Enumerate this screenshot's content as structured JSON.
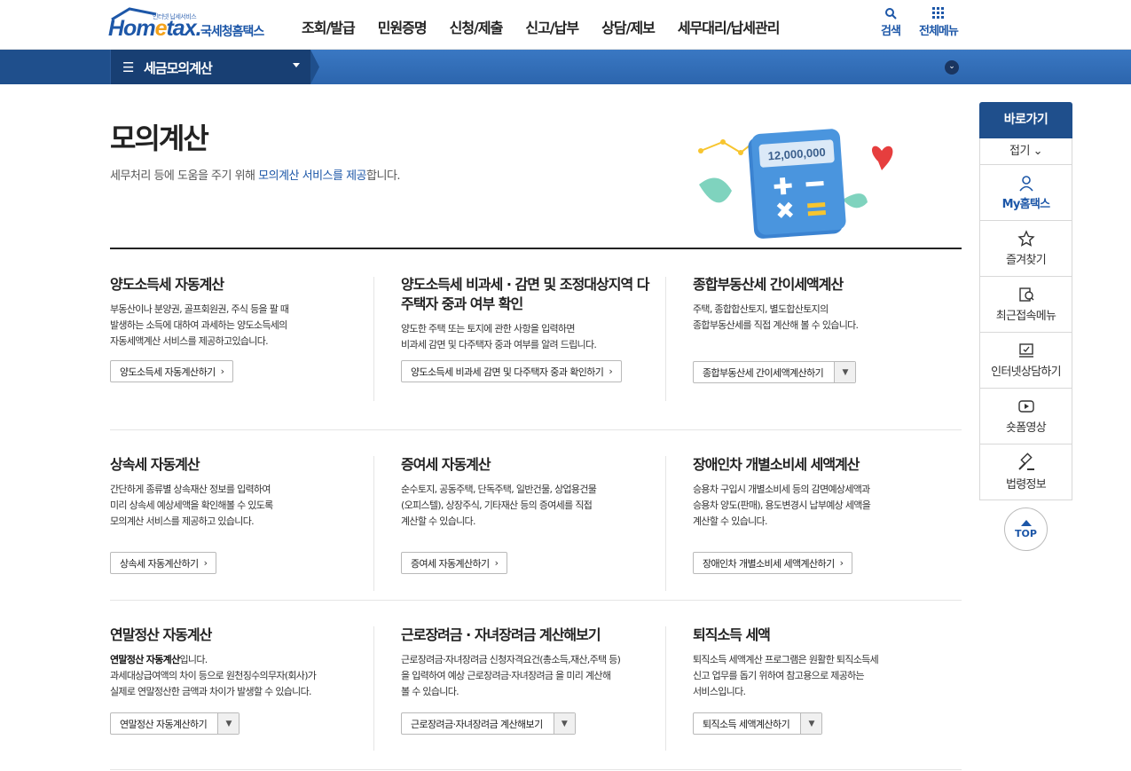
{
  "header": {
    "logo_small": "인터넷 납세서비스",
    "logo_word_start": "Hom",
    "logo_word_e": "e",
    "logo_word_end": "tax.",
    "logo_kor": "국세청홈택스",
    "gnb": [
      "조회/발급",
      "민원증명",
      "신청/제출",
      "신고/납부",
      "상담/제보",
      "세무대리/납세관리"
    ],
    "search_label": "검색",
    "allmenu_label": "전체메뉴"
  },
  "subbar": {
    "title": "세금모의계산"
  },
  "page": {
    "title": "모의계산",
    "desc_pre": "세무처리 등에 도움을 주기 위해 ",
    "desc_hl": "모의계산 서비스를 제공",
    "desc_post": "합니다.",
    "hero_amount": "12,000,000"
  },
  "cards": [
    {
      "title": "양도소득세 자동계산",
      "desc": [
        "부동산이나 분양권, 골프회원권, 주식 등을 팔 때",
        "발생하는 소득에 대하여 과세하는 양도소득세의",
        "자동세액계산 서비스를 제공하고있습니다."
      ],
      "button": "양도소득세 자동계산하기"
    },
    {
      "title": "양도소득세 비과세 · 감면 및 조정대상지역 다주택자 중과 여부 확인",
      "desc": [
        "양도한 주택 또는 토지에 관한 사항을 입력하면",
        "비과세 감면 및 다주택자 중과 여부를 알려 드립니다."
      ],
      "button": "양도소득세 비과세 감면 및 다주택자 중과 확인하기"
    },
    {
      "title": "종합부동산세 간이세액계산",
      "desc": [
        "주택, 종합합산토지, 별도합산토지의",
        "종합부동산세를 직접 계산해 볼 수 있습니다."
      ],
      "button": "종합부동산세 간이세액계산하기"
    },
    {
      "title": "상속세 자동계산",
      "desc": [
        "간단하게 종류별 상속재산 정보를 입력하여",
        "미리 상속세 예상세액을 확인해볼 수 있도록",
        "모의계산 서비스를 제공하고 있습니다."
      ],
      "button": "상속세 자동계산하기"
    },
    {
      "title": "증여세 자동계산",
      "desc": [
        "순수토지, 공동주택, 단독주택, 일반건물, 상업용건물",
        "(오피스텔), 상장주식, 기타재산 등의 증여세를 직접",
        "계산할 수 있습니다."
      ],
      "button": "증여세 자동계산하기"
    },
    {
      "title": "장애인차 개별소비세 세액계산",
      "desc": [
        "승용차 구입시 개별소비세 등의 감면예상세액과",
        "승용차 양도(판매), 용도변경시 납부예상 세액을",
        "계산할 수 있습니다."
      ],
      "button": "장애인차 개별소비세 세액계산하기"
    },
    {
      "title": "연말정산 자동계산",
      "desc_bold": "연말정산 자동계산",
      "desc_bold_post": "입니다.",
      "desc": [
        "과세대상급여액의 차이 등으로 원천징수의무자(회사)가",
        "실제로 연말정산한 금액과 차이가 발생할 수 있습니다."
      ],
      "button": "연말정산 자동계산하기"
    },
    {
      "title": "근로장려금 · 자녀장려금 계산해보기",
      "desc": [
        "근로장려금·자녀장려금 신청자격요건(총소득,재산,주택 등)",
        "을 입력하여 예상 근로장려금·자녀장려금 을 미리 계산해",
        "볼 수 있습니다."
      ],
      "button": "근로장려금·자녀장려금 계산해보기"
    },
    {
      "title": "퇴직소득 세액",
      "desc": [
        "퇴직소득 세액계산 프로그램은 원활한 퇴직소득세",
        "신고 업무를 돕기 위하여 참고용으로 제공하는",
        "서비스입니다."
      ],
      "button": "퇴직소득 세액계산하기"
    }
  ],
  "quick": {
    "head": "바로가기",
    "fold": "접기",
    "items": [
      {
        "label": "My홈택스",
        "icon": "user-icon"
      },
      {
        "label": "즐겨찾기",
        "icon": "star-icon"
      },
      {
        "label": "최근접속메뉴",
        "icon": "recent-icon"
      },
      {
        "label": "인터넷상담하기",
        "icon": "consult-icon"
      },
      {
        "label": "숏폼영상",
        "icon": "video-icon"
      },
      {
        "label": "법령정보",
        "icon": "gavel-icon"
      }
    ],
    "top": "TOP"
  }
}
